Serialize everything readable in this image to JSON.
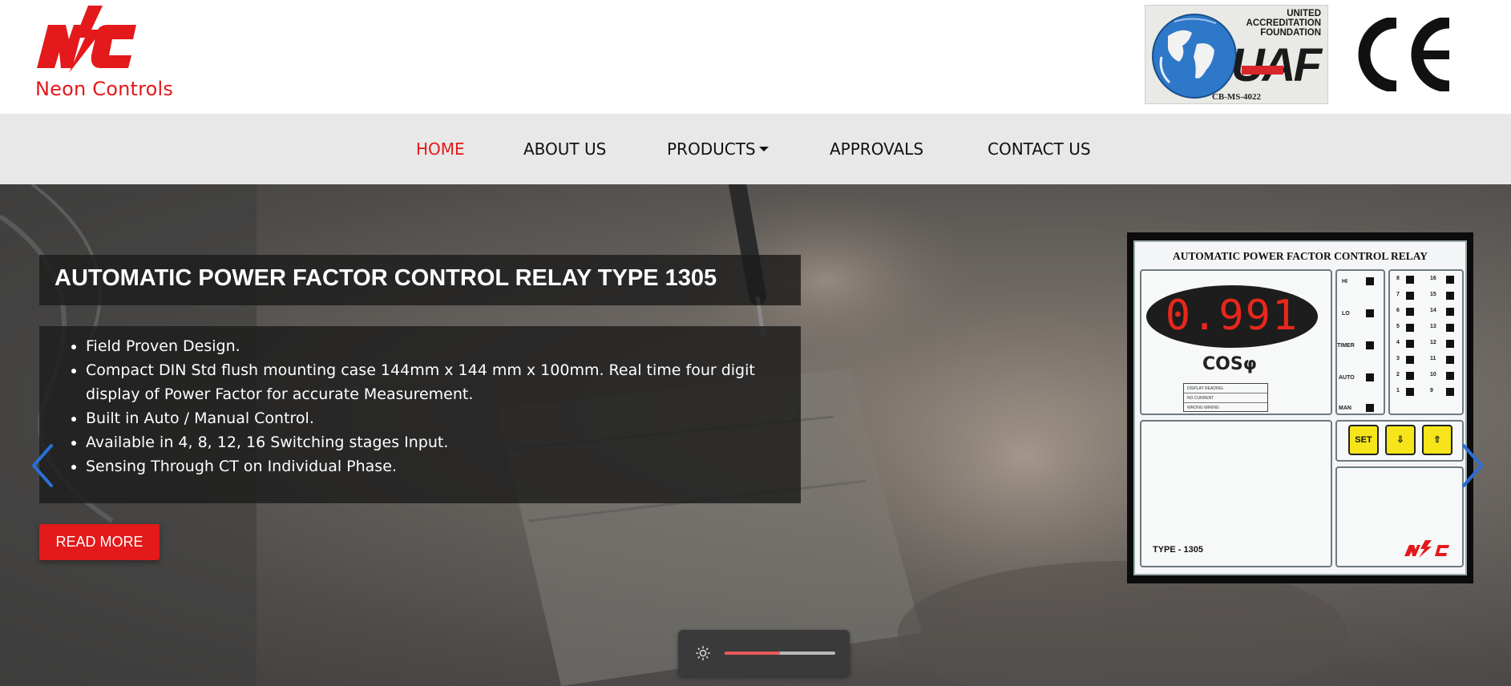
{
  "brand": {
    "name": "Neon Controls",
    "logo_letters": "NC"
  },
  "certifications": {
    "uaf_line1": "UNITED",
    "uaf_line2": "ACCREDITATION",
    "uaf_line3": "FOUNDATION",
    "uaf_letters": "UAF",
    "uaf_cert_no": "CB-MS-4022",
    "ce_text": "CE"
  },
  "nav": {
    "items": [
      {
        "label": "HOME",
        "active": true
      },
      {
        "label": "ABOUT US"
      },
      {
        "label": "PRODUCTS",
        "has_dropdown": true
      },
      {
        "label": "APPROVALS"
      },
      {
        "label": "CONTACT US"
      }
    ]
  },
  "hero": {
    "title": "AUTOMATIC POWER FACTOR CONTROL RELAY TYPE 1305",
    "features": [
      "Field Proven Design.",
      "Compact DIN Std flush mounting case 144mm x 144 mm x 100mm. Real time four digit display of Power Factor for accurate Measurement.",
      "Built in Auto / Manual Control.",
      "Available in 4, 8, 12, 16 Switching stages Input.",
      "Sensing Through CT on Individual Phase."
    ],
    "read_more": "READ MORE",
    "prev_icon": "chevron-left-icon",
    "next_icon": "chevron-right-icon"
  },
  "product_image": {
    "panel_title": "AUTOMATIC POWER FACTOR CONTROL RELAY",
    "display_value": "0.991",
    "cos_label": "COSφ",
    "legend": [
      "DISPLAY READING",
      "NO CURRENT",
      "WRONG WIRING"
    ],
    "status_leds": [
      "HI",
      "LO",
      "TIMER",
      "AUTO",
      "MAN"
    ],
    "stage_left": [
      "8",
      "7",
      "6",
      "5",
      "4",
      "3",
      "2",
      "1"
    ],
    "stage_right": [
      "16",
      "15",
      "14",
      "13",
      "12",
      "11",
      "10",
      "9"
    ],
    "buttons": [
      "SET",
      "⇩",
      "⇧"
    ],
    "type_label": "TYPE - 1305"
  },
  "brightness": {
    "icon": "sun-icon",
    "level": 0.5
  },
  "colors": {
    "brand_red": "#e3191b",
    "nav_bg": "#e8e8e8",
    "overlay": "#1c1c1c",
    "arrow_blue": "#2a6fd6"
  }
}
